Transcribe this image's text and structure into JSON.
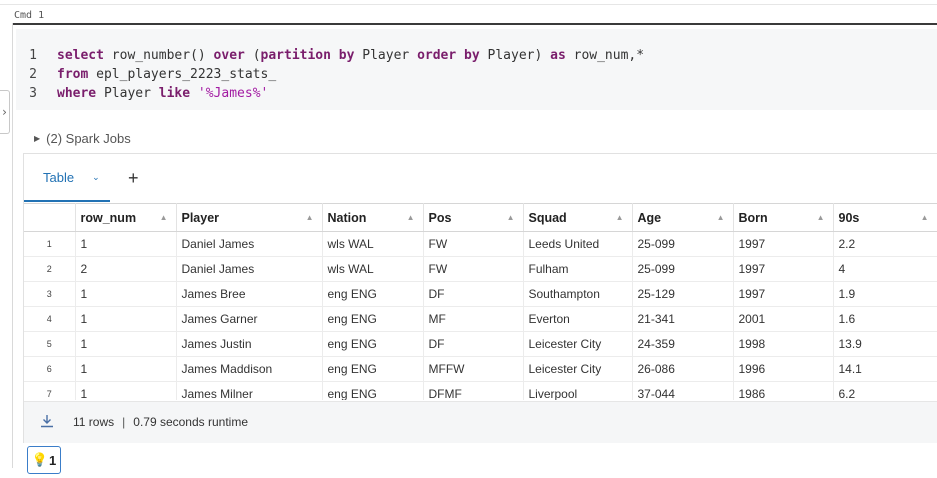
{
  "cell": {
    "cmd_label": "Cmd 1",
    "code_lines": [
      {
        "num": "1",
        "tokens": [
          {
            "t": "kw",
            "v": "select "
          },
          {
            "t": "plain",
            "v": "row_number() "
          },
          {
            "t": "kw",
            "v": "over "
          },
          {
            "t": "plain",
            "v": "("
          },
          {
            "t": "kw",
            "v": "partition by "
          },
          {
            "t": "plain",
            "v": "Player "
          },
          {
            "t": "kw",
            "v": "order by "
          },
          {
            "t": "plain",
            "v": "Player) "
          },
          {
            "t": "kw",
            "v": "as "
          },
          {
            "t": "plain",
            "v": "row_num,*"
          }
        ]
      },
      {
        "num": "2",
        "tokens": [
          {
            "t": "kw",
            "v": "from "
          },
          {
            "t": "plain",
            "v": "epl_players_2223_stats_"
          }
        ]
      },
      {
        "num": "3",
        "tokens": [
          {
            "t": "kw",
            "v": "where "
          },
          {
            "t": "plain",
            "v": "Player "
          },
          {
            "t": "kw",
            "v": "like "
          },
          {
            "t": "str",
            "v": "'%James%'"
          }
        ]
      }
    ]
  },
  "spark_jobs": {
    "label": "(2) Spark Jobs"
  },
  "results": {
    "tab_label": "Table",
    "add_tab_label": "+",
    "columns": [
      "row_num",
      "Player",
      "Nation",
      "Pos",
      "Squad",
      "Age",
      "Born",
      "90s"
    ],
    "rows": [
      {
        "idx": "1",
        "cells": [
          "1",
          "Daniel James",
          "wls WAL",
          "FW",
          "Leeds United",
          "25-099",
          "1997",
          "2.2"
        ]
      },
      {
        "idx": "2",
        "cells": [
          "2",
          "Daniel James",
          "wls WAL",
          "FW",
          "Fulham",
          "25-099",
          "1997",
          "4"
        ]
      },
      {
        "idx": "3",
        "cells": [
          "1",
          "James Bree",
          "eng ENG",
          "DF",
          "Southampton",
          "25-129",
          "1997",
          "1.9"
        ]
      },
      {
        "idx": "4",
        "cells": [
          "1",
          "James Garner",
          "eng ENG",
          "MF",
          "Everton",
          "21-341",
          "2001",
          "1.6"
        ]
      },
      {
        "idx": "5",
        "cells": [
          "1",
          "James Justin",
          "eng ENG",
          "DF",
          "Leicester City",
          "24-359",
          "1998",
          "13.9"
        ]
      },
      {
        "idx": "6",
        "cells": [
          "1",
          "James Maddison",
          "eng ENG",
          "MFFW",
          "Leicester City",
          "26-086",
          "1996",
          "14.1"
        ]
      },
      {
        "idx": "7",
        "cells": [
          "1",
          "James Milner",
          "eng ENG",
          "DFMF",
          "Liverpool",
          "37-044",
          "1986",
          "6.2"
        ]
      }
    ],
    "footer": {
      "rows_text": "11 rows",
      "separator": "|",
      "runtime_text": "0.79 seconds runtime"
    }
  },
  "hint": {
    "count": "1"
  },
  "icons": {
    "download": "download-icon",
    "bulb": "lightbulb-icon",
    "sort": "sort-triangle-icon",
    "chevron": "chevron-down-icon"
  }
}
